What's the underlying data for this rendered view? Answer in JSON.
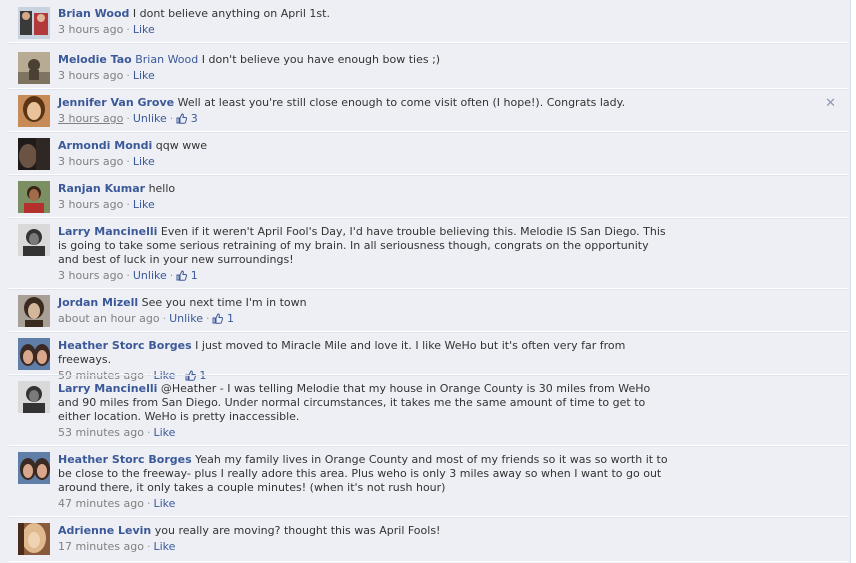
{
  "comments": [
    {
      "author": "Brian Wood",
      "mention": "",
      "text": "I dont believe anything on April 1st.",
      "time": "3 hours ago",
      "action": "Like",
      "likes": "",
      "avatar": {
        "bg": "#c9d3e0",
        "fg": "#3a3a3a",
        "accent": "#b33a3a"
      }
    },
    {
      "author": "Melodie Tao",
      "mention": "Brian Wood",
      "text": " I don't believe you have enough bow ties ;)",
      "time": "3 hours ago",
      "action": "Like",
      "likes": "",
      "avatar": {
        "bg": "#b7ab93",
        "fg": "#4b4034",
        "accent": "#7f7461"
      }
    },
    {
      "author": "Jennifer Van Grove",
      "mention": "",
      "text": "Well at least you're still close enough to come visit often (I hope!). Congrats lady.",
      "time": "3 hours ago",
      "action": "Unlike",
      "likes": "3",
      "avatar": {
        "bg": "#c68b56",
        "fg": "#5a3414",
        "accent": "#e9c29a"
      }
    },
    {
      "author": "Armondi Mondi",
      "mention": "",
      "text": "qqw wwe",
      "time": "3 hours ago",
      "action": "Like",
      "likes": "",
      "avatar": {
        "bg": "#1f1b1a",
        "fg": "#6a5343",
        "accent": "#2e2724"
      }
    },
    {
      "author": "Ranjan Kumar",
      "mention": "",
      "text": "hello",
      "time": "3 hours ago",
      "action": "Like",
      "likes": "",
      "avatar": {
        "bg": "#7c8f63",
        "fg": "#3a2418",
        "accent": "#b3302d"
      }
    },
    {
      "author": "Larry Mancinelli",
      "mention": "",
      "text": "Even if it weren't April Fool's Day, I'd have trouble believing this. Melodie IS San Diego. This is going to take some serious retraining of my brain. In all seriousness though, congrats on the opportunity and best of luck in your new surroundings!",
      "time": "3 hours ago",
      "action": "Unlike",
      "likes": "1",
      "avatar": {
        "bg": "#d9d9d9",
        "fg": "#333333",
        "accent": "#7a7a7a"
      }
    },
    {
      "author": "Jordan Mizell",
      "mention": "",
      "text": "See you next time I'm in town",
      "time": "about an hour ago",
      "action": "Unlike",
      "likes": "1",
      "avatar": {
        "bg": "#a89f95",
        "fg": "#3b2a20",
        "accent": "#d2b79a"
      }
    },
    {
      "author": "Heather Storc Borges",
      "mention": "",
      "text": "I just moved to Miracle Mile and love it. I like WeHo but it's often very far from freeways.",
      "time": "59 minutes ago",
      "action": "Like",
      "likes": "1",
      "avatar": {
        "bg": "#5f7ea8",
        "fg": "#3a2a23",
        "accent": "#d9a88c"
      }
    },
    {
      "author": "Larry Mancinelli",
      "mention": "",
      "text": "@Heather - I was telling Melodie that my house in Orange County is 30 miles from WeHo and 90 miles from San Diego. Under normal circumstances, it takes me the same amount of time to get to either location. WeHo is pretty inaccessible.",
      "time": "53 minutes ago",
      "action": "Like",
      "likes": "",
      "avatar": {
        "bg": "#d9d9d9",
        "fg": "#333333",
        "accent": "#7a7a7a"
      }
    },
    {
      "author": "Heather Storc Borges",
      "mention": "",
      "text": "Yeah my family lives in Orange County and most of my friends so it was so worth it to be close to the freeway- plus I really adore this area. Plus weho is only 3 miles away so when I want to go out around there, it only takes a couple minutes! (when it's not rush hour)",
      "time": "47 minutes ago",
      "action": "Like",
      "likes": "",
      "avatar": {
        "bg": "#5f7ea8",
        "fg": "#3a2a23",
        "accent": "#d9a88c"
      }
    },
    {
      "author": "Adrienne Levin",
      "mention": "",
      "text": "you really are moving? thought this was April Fools!",
      "time": "17 minutes ago",
      "action": "Like",
      "likes": "",
      "avatar": {
        "bg": "#8a5a3c",
        "fg": "#e1b98f",
        "accent": "#4a2c1c"
      }
    }
  ],
  "close_glyph": "✕"
}
